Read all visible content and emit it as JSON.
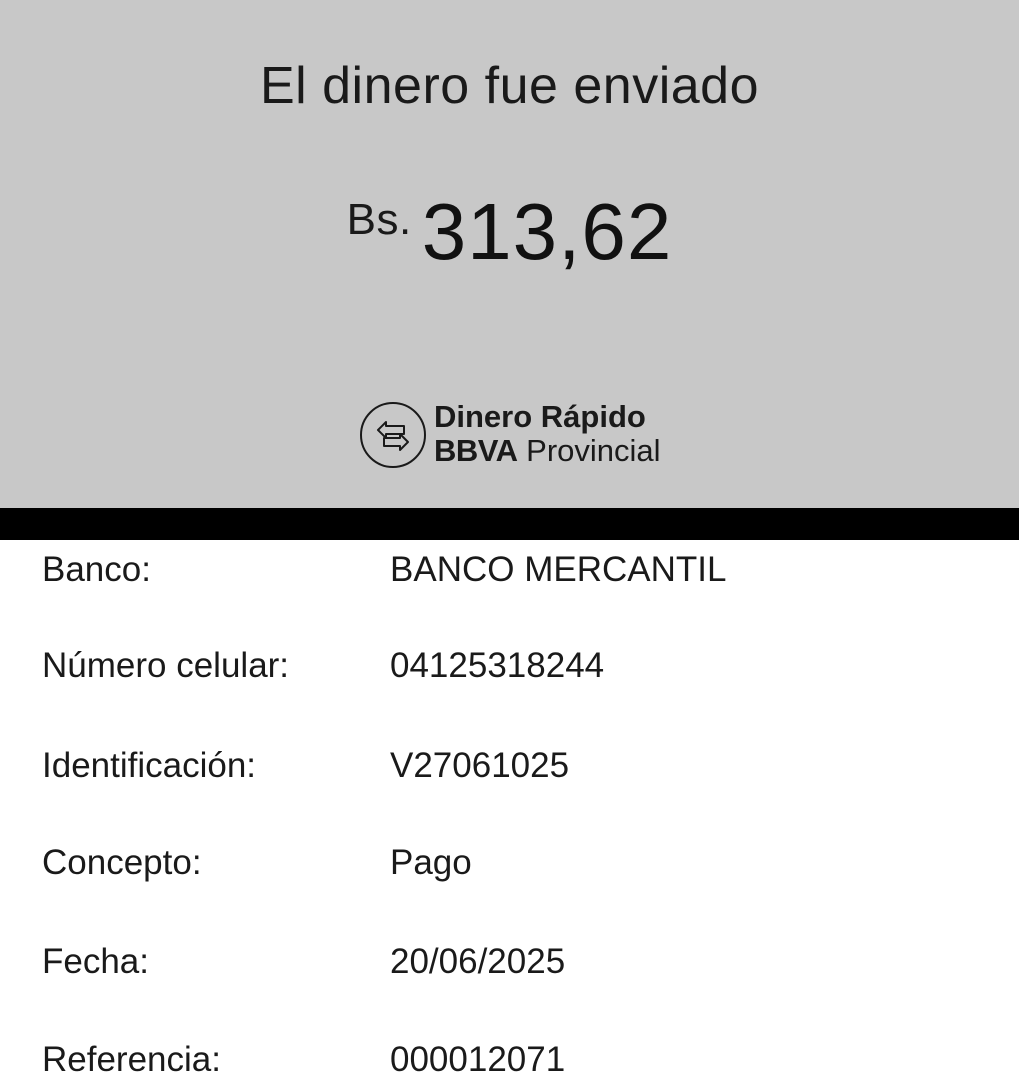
{
  "header": {
    "title": "El dinero fue enviado",
    "currency": "Bs.",
    "amount": "313,62"
  },
  "brand": {
    "line1": "Dinero Rápido",
    "bank": "BBVA",
    "region": "Provincial",
    "icon": "transfer-arrows-icon"
  },
  "details": [
    {
      "label": "Banco:",
      "value": "BANCO MERCANTIL"
    },
    {
      "label": "Número celular:",
      "value": "04125318244"
    },
    {
      "label": "Identificación:",
      "value": "V27061025"
    },
    {
      "label": "Concepto:",
      "value": "Pago"
    },
    {
      "label": "Fecha:",
      "value": "20/06/2025"
    },
    {
      "label": "Referencia:",
      "value": "000012071"
    }
  ],
  "colors": {
    "header_bg": "#c8c8c8",
    "band": "#000000",
    "text": "#1a1a1a"
  }
}
